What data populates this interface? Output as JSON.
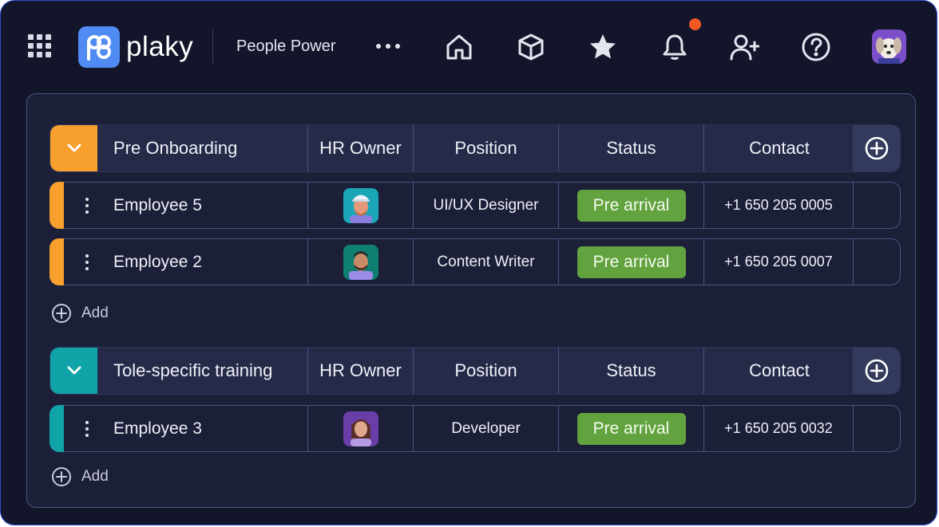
{
  "app": {
    "brand": "plaky",
    "workspace": "People Power"
  },
  "colors": {
    "accent_orange": "#f7a02d",
    "accent_teal": "#10a3a8",
    "status_green": "#62a33f",
    "notification": "#f05a24",
    "brand_blue": "#4f8bf2"
  },
  "icons": {
    "apps": "grid-icon",
    "more": "more-icon",
    "home": "home-icon",
    "cube": "cube-icon",
    "favorites": "star-icon",
    "notifications": "bell-icon",
    "invite": "add-user-icon",
    "help": "help-icon"
  },
  "columns": {
    "hr_owner": "HR Owner",
    "position": "Position",
    "status": "Status",
    "contact": "Contact"
  },
  "groups": [
    {
      "name": "Pre Onboarding",
      "rows": [
        {
          "name": "Employee 5",
          "position": "UI/UX Designer",
          "status": "Pre arrival",
          "contact": "+1 650 205 0005"
        },
        {
          "name": "Employee 2",
          "position": "Content Writer",
          "status": "Pre arrival",
          "contact": "+1 650 205 0007"
        }
      ],
      "add_label": "Add"
    },
    {
      "name": "Tole-specific training",
      "rows": [
        {
          "name": "Employee 3",
          "position": "Developer",
          "status": "Pre arrival",
          "contact": "+1 650 205 0032"
        }
      ],
      "add_label": "Add"
    }
  ]
}
